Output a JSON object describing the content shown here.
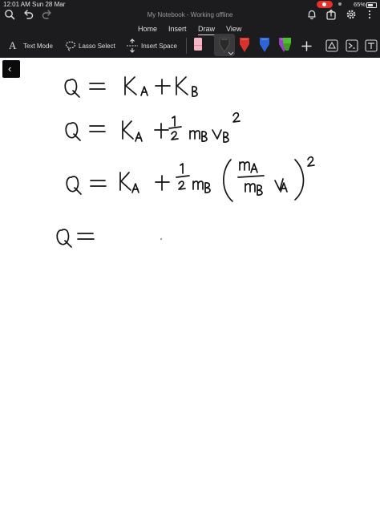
{
  "status_bar": {
    "time": "12:01 AM   Sun 28 Mar",
    "battery": "65%"
  },
  "window": {
    "title": "My Notebook - Working offline"
  },
  "tabs": [
    {
      "label": "Home"
    },
    {
      "label": "Insert"
    },
    {
      "label": "Draw"
    },
    {
      "label": "View"
    }
  ],
  "active_tab": "Draw",
  "ribbon": {
    "text_mode": "Text Mode",
    "lasso_select": "Lasso Select",
    "insert_space": "Insert Space"
  },
  "pens": [
    {
      "icon": "highlighter-eraser-icon",
      "color": "#f4b6c2"
    },
    {
      "icon": "pen-black-icon",
      "color": "#2a2a2a"
    },
    {
      "icon": "pen-red-icon",
      "color": "#d8322b"
    },
    {
      "icon": "pen-blue-icon",
      "color": "#2f64d6"
    },
    {
      "icon": "pen-purple-icon",
      "color": "#9a3fc4"
    },
    {
      "icon": "highlighter-green-icon",
      "color": "#4bbf2f"
    }
  ],
  "handwriting": {
    "line1": "Q = K_A + K_B",
    "line2": "Q = K_A + 1/2 m_B v_B^2",
    "line3": "Q = K_A + 1/2 m_B (m_A/m_B v_A)^2",
    "line4": "Q ="
  }
}
